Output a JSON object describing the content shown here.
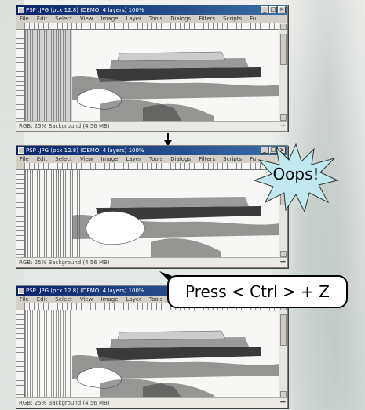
{
  "app": {
    "title": "PSP .JPG (pcx 12.8) (DEMO, 4 layers) 100%",
    "menu": [
      "File",
      "Edit",
      "Select",
      "View",
      "Image",
      "Layer",
      "Tools",
      "Dialogs",
      "Filters",
      "Scripts",
      "Fu"
    ],
    "status": "RGB: 25%  Background (4.56 MB)"
  },
  "frames": [
    {
      "id": "frame-original"
    },
    {
      "id": "frame-mistake"
    },
    {
      "id": "frame-undone"
    }
  ],
  "overlay": {
    "oops_text": "Oops!",
    "instruction_text": "Press < Ctrl > + Z"
  },
  "colors": {
    "titlebar": "#0a246a",
    "oops_fill": "#bfe9ee",
    "callout_border": "#000000"
  },
  "icons": [
    "down-arrow-icon",
    "starburst-icon",
    "navigation-cross-icon"
  ]
}
